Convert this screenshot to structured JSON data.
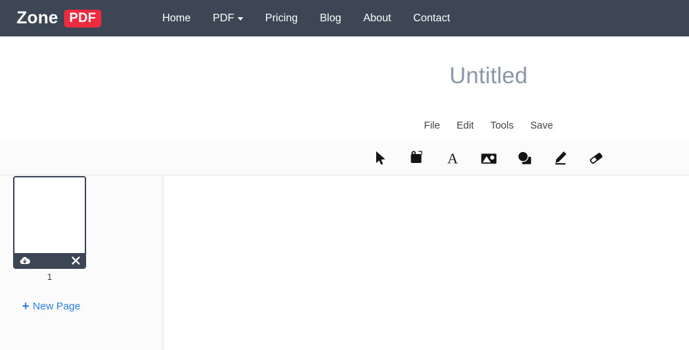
{
  "navbar": {
    "brand": {
      "primary": "Zone",
      "badge": "PDF",
      "badge_color": "#ed2b3f"
    },
    "background_color": "#3c4654",
    "links": [
      {
        "label": "Home",
        "has_caret": false
      },
      {
        "label": "PDF",
        "has_caret": true
      },
      {
        "label": "Pricing",
        "has_caret": false
      },
      {
        "label": "Blog",
        "has_caret": false
      },
      {
        "label": "About",
        "has_caret": false
      },
      {
        "label": "Contact",
        "has_caret": false
      }
    ]
  },
  "document": {
    "title": "Untitled",
    "title_color": "#8a95a5",
    "menu": [
      {
        "label": "File"
      },
      {
        "label": "Edit"
      },
      {
        "label": "Tools"
      },
      {
        "label": "Save"
      }
    ]
  },
  "toolbar": {
    "background_color": "#fbfbfb",
    "tools": [
      {
        "icon": "cursor-select-icon",
        "label": "Select"
      },
      {
        "icon": "sticky-note-icon",
        "label": "Note"
      },
      {
        "icon": "text-icon",
        "label": "Text"
      },
      {
        "icon": "image-icon",
        "label": "Image"
      },
      {
        "icon": "shapes-icon",
        "label": "Shapes"
      },
      {
        "icon": "pencil-icon",
        "label": "Draw"
      },
      {
        "icon": "eraser-icon",
        "label": "Erase"
      }
    ]
  },
  "sidebar": {
    "background_color": "#fbfbfb",
    "pages": [
      {
        "number": "1",
        "download_icon": "cloud-download-icon",
        "remove_icon": "close-icon"
      }
    ],
    "new_page": {
      "label": "New Page",
      "icon": "plus-icon",
      "color": "#2b7fe8"
    }
  },
  "canvas": {
    "background_color": "#ffffff"
  }
}
